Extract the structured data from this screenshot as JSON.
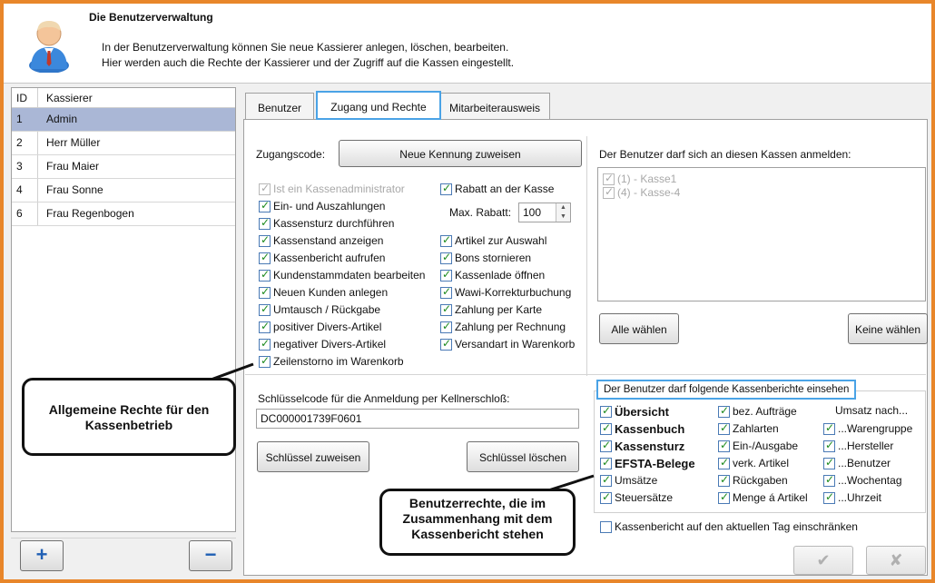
{
  "header": {
    "title": "Die Benutzerverwaltung",
    "line1": "In der Benutzerverwaltung können Sie neue Kassierer anlegen, löschen, bearbeiten.",
    "line2": "Hier werden auch die Rechte der Kassierer und der Zugriff auf die Kassen eingestellt."
  },
  "userlist": {
    "col_id": "ID",
    "col_name": "Kassierer",
    "rows": [
      {
        "id": "1",
        "name": "Admin",
        "selected": true
      },
      {
        "id": "2",
        "name": "Herr Müller"
      },
      {
        "id": "3",
        "name": "Frau Maier"
      },
      {
        "id": "4",
        "name": "Frau Sonne"
      },
      {
        "id": "6",
        "name": "Frau Regenbogen"
      }
    ],
    "add_icon": "plus-icon",
    "remove_icon": "minus-icon"
  },
  "tabs": [
    "Benutzer",
    "Zugang und Rechte",
    "Mitarbeiterausweis"
  ],
  "access": {
    "code_label": "Zugangscode:",
    "new_id_button": "Neue Kennung zuweisen",
    "rights_left": [
      "Ist ein Kassenadministrator",
      "Ein- und Auszahlungen",
      "Kassensturz durchführen",
      "Kassenstand anzeigen",
      "Kassenbericht aufrufen",
      "Kundenstammdaten bearbeiten",
      "Neuen Kunden anlegen",
      "Umtausch / Rückgabe",
      "positiver Divers-Artikel",
      "negativer Divers-Artikel",
      "Zeilenstorno im Warenkorb"
    ],
    "discount_label": "Rabatt an der Kasse",
    "max_discount_label": "Max. Rabatt:",
    "max_discount_value": "100",
    "rights_right": [
      "Artikel zur Auswahl",
      "Bons stornieren",
      "Kassenlade öffnen",
      "Wawi-Korrekturbuchung",
      "Zahlung per Karte",
      "Zahlung per Rechnung",
      "Versandart in Warenkorb"
    ]
  },
  "kassen": {
    "label": "Der Benutzer darf sich an diesen Kassen anmelden:",
    "items": [
      "(1) - Kasse1",
      "(4) - Kasse-4"
    ],
    "select_all": "Alle wählen",
    "select_none": "Keine wählen"
  },
  "keycode": {
    "label": "Schlüsselcode für die Anmeldung per Kellnerschloß:",
    "value": "DC000001739F0601",
    "assign_button": "Schlüssel zuweisen",
    "delete_button": "Schlüssel löschen"
  },
  "reports": {
    "title": "Der Benutzer darf folgende Kassenberichte einsehen",
    "col1": [
      "Übersicht",
      "Kassenbuch",
      "Kassensturz",
      "EFSTA-Belege",
      "Umsätze",
      "Steuersätze"
    ],
    "col2": [
      "bez. Aufträge",
      "Zahlarten",
      "Ein-/Ausgabe",
      "verk. Artikel",
      "Rückgaben",
      "Menge á Artikel"
    ],
    "col3_heading": "Umsatz nach...",
    "col3": [
      "...Warengruppe",
      "...Hersteller",
      "...Benutzer",
      "...Wochentag",
      "...Uhrzeit"
    ],
    "restrict_label": "Kassenbericht auf den aktuellen Tag einschränken"
  },
  "callouts": {
    "general": "Allgemeine Rechte für den Kassenbetrieb",
    "report": "Benutzerrechte, die im Zusammenhang mit dem Kassenbericht stehen"
  },
  "footer": {
    "ok_icon": "checkmark-icon",
    "ok_glyph": "✔",
    "cancel_icon": "cross-icon",
    "cancel_glyph": "✘"
  },
  "colors": {
    "frame": "#e8862a",
    "selection": "#aab7d6",
    "highlight": "#4aa3e6",
    "check": "#1c8a1c"
  }
}
